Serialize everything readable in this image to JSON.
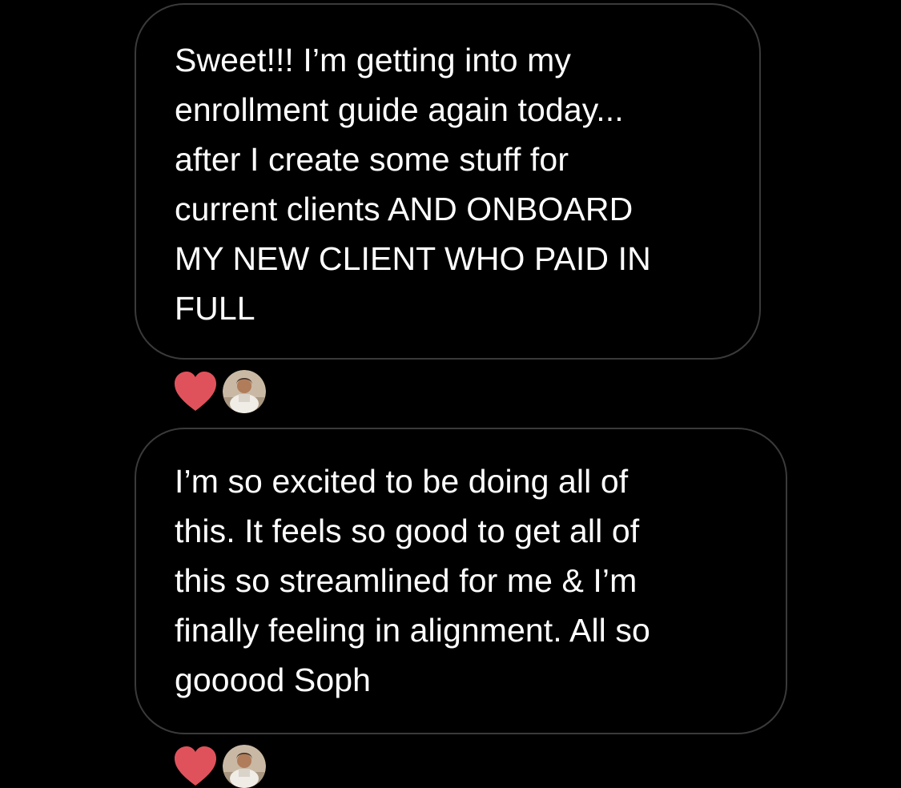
{
  "messages": [
    {
      "text": "Sweet!!! I’m getting into my\nenrollment guide again today...\nafter I create some stuff for\ncurrent clients AND ONBOARD\nMY NEW CLIENT WHO PAID IN\nFULL",
      "reaction": "heart-icon"
    },
    {
      "text": "I’m so excited to be doing all of\nthis. It feels so good to get all of\nthis so streamlined for me & I’m\nfinally feeling in alignment. All so\ngooood Soph",
      "reaction": "heart-icon"
    }
  ],
  "colors": {
    "background": "#000000",
    "bubble_border": "#3a3a3c",
    "text": "#ffffff",
    "heart": "#e0525b"
  }
}
